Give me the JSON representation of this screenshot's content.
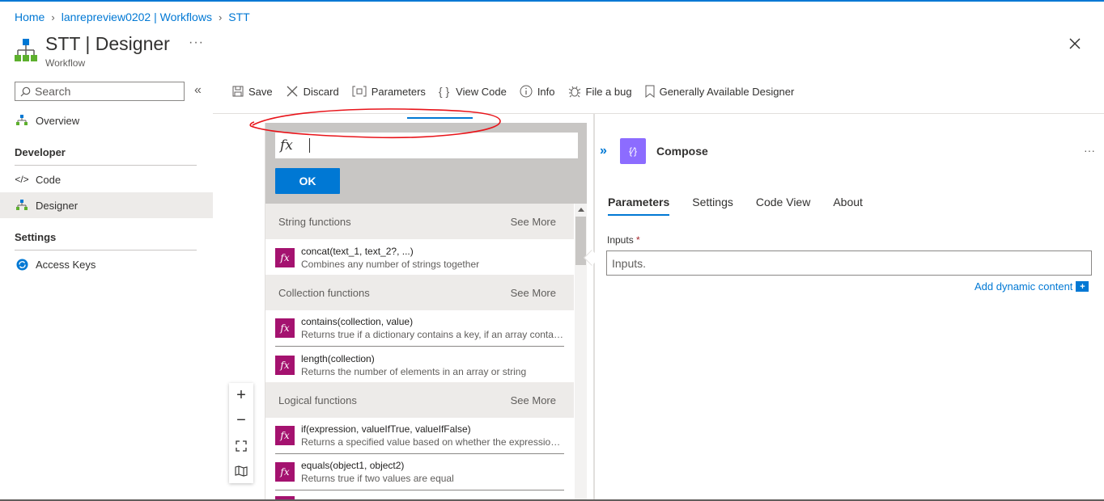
{
  "breadcrumb": [
    "Home",
    "lanrepreview0202 | Workflows",
    "STT"
  ],
  "header": {
    "title": "STT | Designer",
    "subtitle": "Workflow",
    "more_label": "···"
  },
  "sidebar": {
    "search_placeholder": "Search",
    "collapse_label": "«",
    "overview": "Overview",
    "groups": {
      "developer": "Developer",
      "settings": "Settings"
    },
    "items": {
      "code": "Code",
      "designer": "Designer",
      "access_keys": "Access Keys"
    }
  },
  "toolbar": {
    "save": "Save",
    "discard": "Discard",
    "parameters": "Parameters",
    "view_code": "View Code",
    "info": "Info",
    "file_bug": "File a bug",
    "ga_designer": "Generally Available Designer"
  },
  "expression": {
    "fx_label": "fx",
    "input_value": "",
    "ok_label": "OK",
    "see_more": "See More",
    "categories": [
      {
        "label": "String functions",
        "functions": [
          {
            "name": "concat(text_1, text_2?, ...)",
            "desc": "Combines any number of strings together"
          }
        ]
      },
      {
        "label": "Collection functions",
        "functions": [
          {
            "name": "contains(collection, value)",
            "desc": "Returns true if a dictionary contains a key, if an array contains a value, or if a string contains a substring"
          },
          {
            "name": "length(collection)",
            "desc": "Returns the number of elements in an array or string"
          }
        ]
      },
      {
        "label": "Logical functions",
        "functions": [
          {
            "name": "if(expression, valueIfTrue, valueIfFalse)",
            "desc": "Returns a specified value based on whether the expression resulted in true or false"
          },
          {
            "name": "equals(object1, object2)",
            "desc": "Returns true if two values are equal"
          }
        ]
      }
    ]
  },
  "zoom": {
    "zoom_in": "+",
    "zoom_out": "−"
  },
  "panel": {
    "expand_label": "»",
    "action_icon_label": "{⁄}",
    "action_title": "Compose",
    "more_label": "···",
    "tabs": [
      "Parameters",
      "Settings",
      "Code View",
      "About"
    ],
    "inputs_label": "Inputs",
    "required_mark": "*",
    "inputs_placeholder": "Inputs.",
    "add_dynamic": "Add dynamic content",
    "add_icon": "+"
  },
  "colors": {
    "accent": "#0078d4",
    "function_icon": "#a4126f",
    "compose_icon": "#8c6cff",
    "annotation": "#e8141a"
  }
}
